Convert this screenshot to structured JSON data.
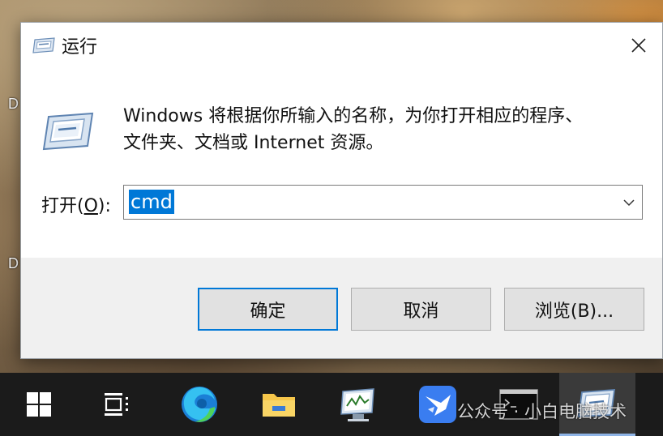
{
  "desktop": {
    "icon_letters": [
      "D",
      "D"
    ]
  },
  "dialog": {
    "title": "运行",
    "description_line1": "Windows 将根据你所输入的名称，为你打开相应的程序、",
    "description_line2": "文件夹、文档或 Internet 资源。",
    "open_label_prefix": "打开(",
    "open_label_mnemonic": "O",
    "open_label_suffix": "):",
    "input_value": "cmd",
    "buttons": {
      "ok": "确定",
      "cancel": "取消",
      "browse": "浏览(B)..."
    }
  },
  "taskbar": {
    "items": [
      "start-icon",
      "task-view-icon",
      "edge-icon",
      "file-explorer-icon",
      "system-monitor-icon",
      "feishu-icon",
      "command-prompt-icon",
      "run-icon"
    ]
  },
  "watermark": "公众号 · 小白电脑技术",
  "colors": {
    "accent": "#0078d7",
    "dialog_bg": "#f0f0f0",
    "taskbar_bg": "#1b1b1b"
  }
}
